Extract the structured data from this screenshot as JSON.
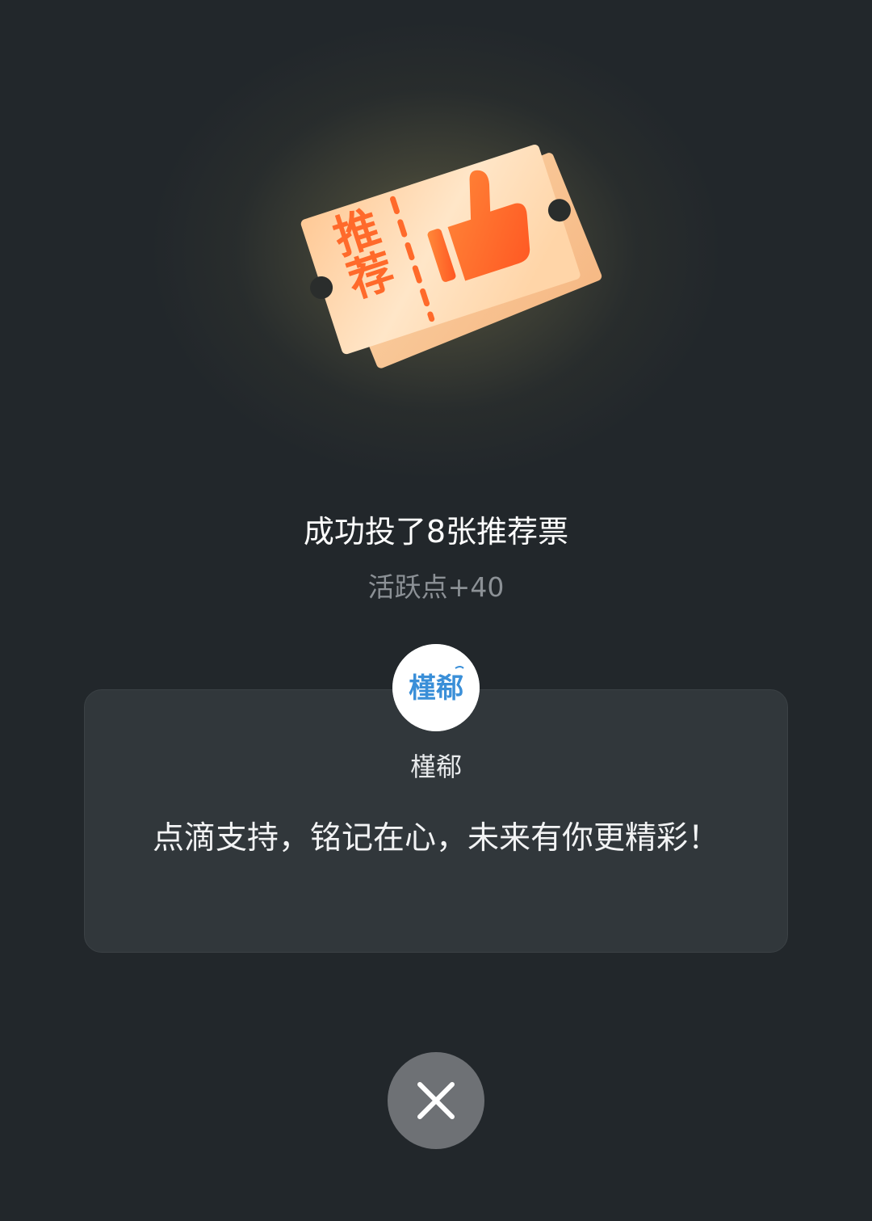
{
  "illustration": {
    "icon": "recommendation-ticket-thumbs-up",
    "ticket_text": "推荐",
    "accent_color": "#ff6a2b",
    "ticket_color": "#fbd9b0"
  },
  "result": {
    "title": "成功投了8张推荐票",
    "subtitle": "活跃点+40"
  },
  "author_card": {
    "avatar_text": "槿郗",
    "name": "槿郗",
    "message": "点滴支持，铭记在心，未来有你更精彩！"
  },
  "close": {
    "icon": "close-icon"
  },
  "colors": {
    "background": "#22272b",
    "card": "#31373b",
    "close_button": "#6e7175"
  }
}
